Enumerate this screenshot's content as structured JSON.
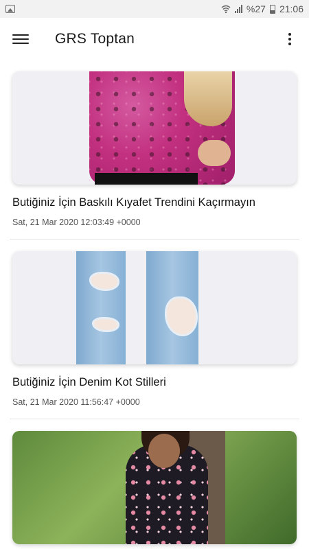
{
  "status_bar": {
    "battery_text": "%27",
    "time": "21:06",
    "icons": [
      "gallery-icon",
      "wifi-icon",
      "signal-icon",
      "battery-icon"
    ]
  },
  "app_bar": {
    "title": "GRS Toptan",
    "menu_icon": "hamburger-menu-icon",
    "overflow_icon": "more-vert-icon"
  },
  "articles": [
    {
      "title": "Butiğiniz İçin Baskılı Kıyafet Trendini Kaçırmayın",
      "date": "Sat, 21 Mar 2020 12:03:49 +0000",
      "image": "pink snakeskin print top"
    },
    {
      "title": "Butiğiniz İçin Denim Kot Stilleri",
      "date": "Sat, 21 Mar 2020 11:56:47 +0000",
      "image": "ripped light-blue jeans"
    },
    {
      "title": "",
      "date": "",
      "image": "woman in floral dress outdoors"
    }
  ],
  "colors": {
    "status_bar_bg": "#f2f2f2",
    "app_bar_bg": "#ffffff",
    "text_primary": "#111111",
    "text_secondary": "#555555",
    "divider": "#e2e2e2"
  }
}
